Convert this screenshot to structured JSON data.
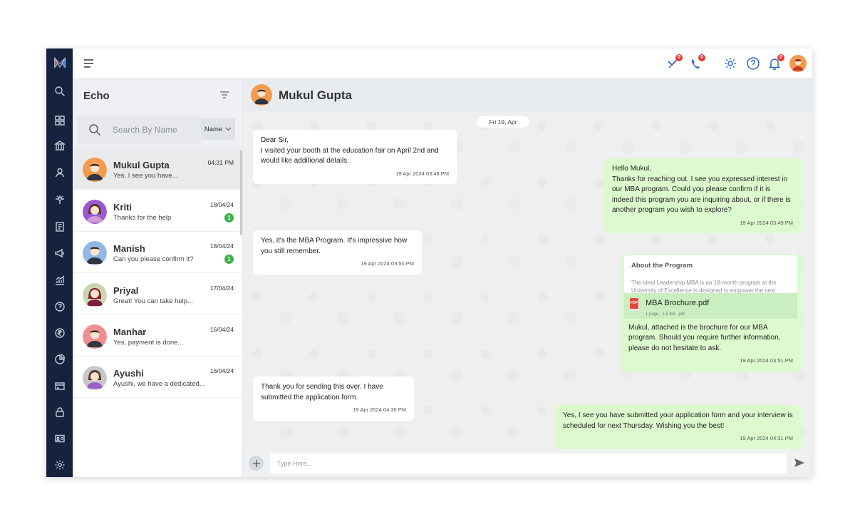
{
  "rail": {
    "items": [
      "search-icon",
      "dashboard-icon",
      "bank-icon",
      "user-icon",
      "network-icon",
      "document-icon",
      "megaphone-icon",
      "analytics-icon",
      "help-icon",
      "rupee-icon",
      "pie-chart-icon",
      "card-icon",
      "lock-icon",
      "id-card-icon",
      "settings-icon"
    ]
  },
  "topbar": {
    "badges": {
      "missed_calls": "0",
      "calls": "0",
      "notifications": "0"
    }
  },
  "list": {
    "title": "Echo",
    "search_placeholder": "Search By Name",
    "sort_label": "Name",
    "conversations": [
      {
        "name": "Mukul Gupta",
        "preview": "Yes, I see you have...",
        "time": "04:31 PM",
        "badge": ""
      },
      {
        "name": "Kriti",
        "preview": "Thanks for the help",
        "time": "18/04/24",
        "badge": "1"
      },
      {
        "name": "Manish",
        "preview": "Can you please confirm it?",
        "time": "18/04/24",
        "badge": "1"
      },
      {
        "name": "Priyal",
        "preview": "Great! You can take help...",
        "time": "17/04/24",
        "badge": ""
      },
      {
        "name": "Manhar",
        "preview": "Yes, payment is done...",
        "time": "16/04/24",
        "badge": ""
      },
      {
        "name": "Ayushi",
        "preview": "Ayushi, we have a dedicated...",
        "time": "16/04/24",
        "badge": ""
      }
    ]
  },
  "chat": {
    "contact_name": "Mukul Gupta",
    "date_chip": "Fri 19, Apr",
    "messages": [
      {
        "dir": "in",
        "text": "Dear Sir,\nI visited your booth at the education fair on April 2nd and would like additional details.",
        "time": "19 Apr 2024 03:48 PM"
      },
      {
        "dir": "out",
        "text": "Hello Mukul,\nThanks for reaching out. I see you expressed interest in our MBA program. Could you please confirm if it is indeed this program you are inquiring about, or if there is another program you wish to explore?",
        "time": "19 Apr 2024 03:49 PM"
      },
      {
        "dir": "in",
        "text": "Yes, it's the MBA Program. It's impressive how you still remember.",
        "time": "19 Apr 2024 03:50 PM"
      },
      {
        "dir": "out",
        "text": "Mukul, attached is the brochure for our MBA program. Should you require further information, please do not hesitate to ask.",
        "time": "19 Apr 2024 03:51 PM"
      },
      {
        "dir": "in",
        "text": "Thank you for sending this over. I have submitted the application form.",
        "time": "19 Apr 2024 04:30 PM"
      },
      {
        "dir": "out",
        "text": "Yes, I see you have submitted your application form and your interview is scheduled for next Thursday. Wishing you the best!",
        "time": "19 Apr 2024 04:31 PM"
      }
    ],
    "attachment": {
      "title": "About the Program",
      "description": "The Ideal Leadership MBA is an 18-month program at the University of Excellence is designed to empower the next generation of global business leaders",
      "file_name": "MBA Brochure.pdf",
      "file_meta": "1 page . 1.5 KB . pdf",
      "file_tag": "PDF"
    },
    "composer_placeholder": "Type Here..."
  },
  "colors": {
    "rail": "#16233f",
    "incoming_bubble": "#ffffff",
    "outgoing_bubble": "#dcfacd",
    "badge_green": "#3cb34a",
    "accent_blue": "#2a66c8",
    "notify_red": "#e53935"
  }
}
